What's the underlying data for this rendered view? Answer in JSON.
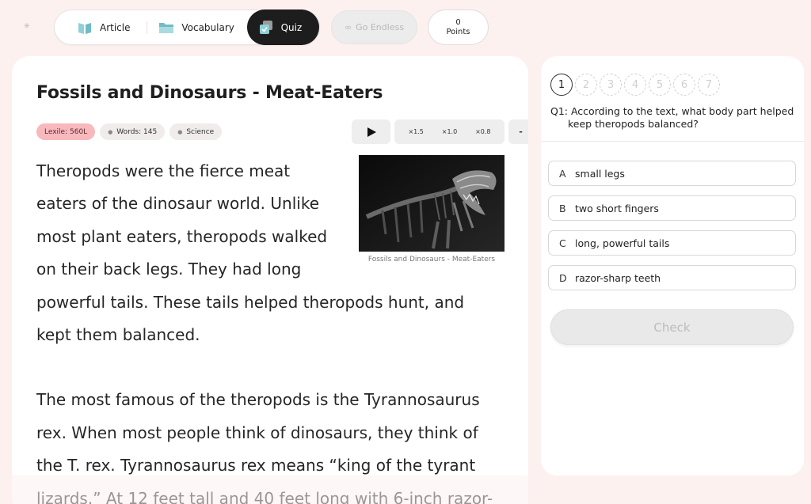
{
  "nav": {
    "tabs": [
      {
        "label": "Article",
        "icon": "book-icon"
      },
      {
        "label": "Vocabulary",
        "icon": "folder-icon"
      },
      {
        "label": "Quiz",
        "icon": "quiz-check-icon"
      }
    ],
    "active_tab": "Quiz",
    "endless_label": "Go Endless",
    "points_value": "0",
    "points_label": "Points"
  },
  "article": {
    "title": "Fossils and Dinosaurs - Meat-Eaters",
    "badges": {
      "lexile": "Lexile: 560L",
      "words": "Words: 145",
      "subject": "Science"
    },
    "audio": {
      "speeds": [
        "×1.5",
        "×1.0",
        "×0.8"
      ],
      "minus": "-"
    },
    "image_caption": "Fossils and Dinosaurs - Meat-Eaters",
    "paragraphs": [
      "Theropods were the fierce meat eaters of the dinosaur world. Unlike most plant eaters, theropods walked on their back legs. They had long powerful tails. These tails helped theropods hunt, and kept them balanced.",
      "The most famous of the theropods is the Tyrannosaurus rex. When most people think of dinosaurs, they think of the T. rex. Tyrannosaurus rex means “king of the tyrant lizards.” At 12 feet tall and 40 feet long with 6-inch razor-"
    ]
  },
  "quiz": {
    "question_numbers": [
      "1",
      "2",
      "3",
      "4",
      "5",
      "6",
      "7"
    ],
    "current": 1,
    "question": "Q1: According to the text, what body part helped keep theropods balanced?",
    "options": [
      {
        "letter": "A",
        "text": "small legs"
      },
      {
        "letter": "B",
        "text": "two short fingers"
      },
      {
        "letter": "C",
        "text": "long, powerful tails"
      },
      {
        "letter": "D",
        "text": "razor-sharp teeth"
      }
    ],
    "check_label": "Check"
  },
  "colors": {
    "background": "#fdf1f0",
    "active_tab": "#1d1d1d",
    "lexile_badge": "#f8b9bd",
    "book_icon": "#8fd0d6"
  }
}
